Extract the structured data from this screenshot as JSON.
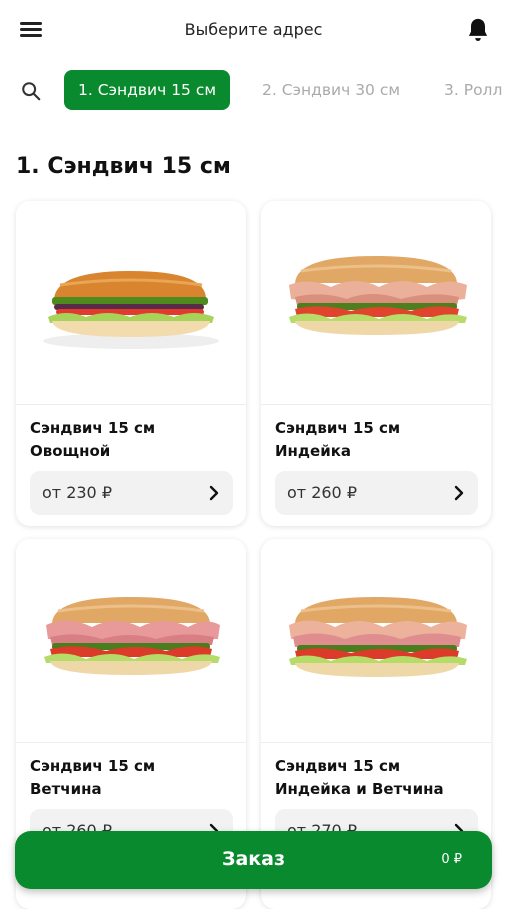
{
  "header": {
    "address_label": "Выберите адрес",
    "icons": [
      "menu-icon",
      "bell-icon"
    ]
  },
  "categories": {
    "search_icon": "search-icon",
    "tabs": [
      {
        "label": "1. Сэндвич 15 см",
        "active": true
      },
      {
        "label": "2. Сэндвич 30 см",
        "active": false
      },
      {
        "label": "3. Ролл",
        "active": false
      }
    ]
  },
  "section": {
    "title": "1. Сэндвич 15 см"
  },
  "products": [
    {
      "name_line1": "Сэндвич 15 см",
      "name_line2": "Овощной",
      "price": "от 230 ₽"
    },
    {
      "name_line1": "Сэндвич 15 см",
      "name_line2": "Индейка",
      "price": "от 260 ₽"
    },
    {
      "name_line1": "Сэндвич 15 см",
      "name_line2": "Ветчина",
      "price": "от 260 ₽"
    },
    {
      "name_line1": "Сэндвич 15 см",
      "name_line2": "Индейка и Ветчина",
      "price": "от 270 ₽"
    }
  ],
  "order": {
    "label": "Заказ",
    "total": "0 ₽"
  },
  "colors": {
    "accent": "#0a8a2e",
    "card_bg": "#ffffff",
    "price_bg": "#f2f2f2"
  }
}
